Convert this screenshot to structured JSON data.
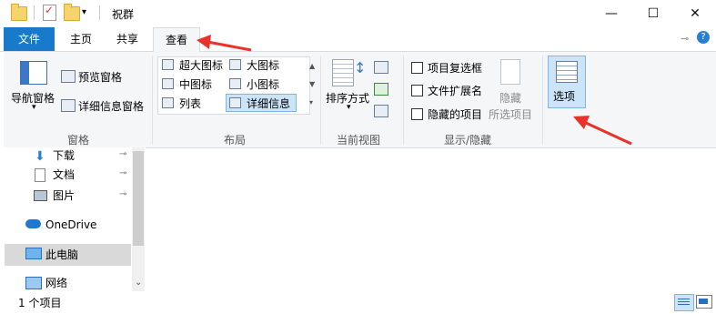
{
  "window": {
    "title": "祝群",
    "minimize_icon": "—",
    "maximize_icon": "☐",
    "close_icon": "✕"
  },
  "tabs": {
    "file": "文件",
    "home": "主页",
    "share": "共享",
    "view": "查看"
  },
  "ribbon": {
    "pane_group": {
      "nav_pane": "导航窗格",
      "preview_pane": "预览窗格",
      "details_pane": "详细信息窗格",
      "label": "窗格"
    },
    "layout_group": {
      "extra_large_icons": "超大图标",
      "large_icons": "大图标",
      "medium_icons": "中图标",
      "small_icons": "小图标",
      "list": "列表",
      "details": "详细信息",
      "label": "布局"
    },
    "current_view_group": {
      "sort_by": "排序方式",
      "label": "当前视图"
    },
    "show_hide_group": {
      "item_checkboxes": "项目复选框",
      "file_extensions": "文件扩展名",
      "hidden_items": "隐藏的项目",
      "hide": "隐藏",
      "hide_selected": "所选项目",
      "label": "显示/隐藏"
    },
    "options": "选项"
  },
  "navigation": {
    "items": [
      {
        "label": "下载"
      },
      {
        "label": "文档"
      },
      {
        "label": "图片"
      },
      {
        "label": "OneDrive"
      },
      {
        "label": "此电脑"
      },
      {
        "label": "网络"
      }
    ]
  },
  "status": {
    "item_count": "1 个项目"
  },
  "colors": {
    "accent": "#1979ca",
    "annotation_arrow": "#e8322b",
    "ribbon_bg": "#f5f6f7",
    "selected_bg": "#d9d9d9"
  }
}
